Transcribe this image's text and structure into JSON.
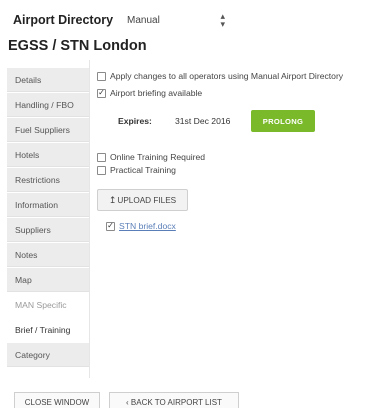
{
  "header": {
    "app_title": "Airport Directory",
    "mode_value": "Manual",
    "airport_title": "EGSS / STN London"
  },
  "tabs": [
    {
      "label": "Details"
    },
    {
      "label": "Handling / FBO"
    },
    {
      "label": "Fuel Suppliers"
    },
    {
      "label": "Hotels"
    },
    {
      "label": "Restrictions"
    },
    {
      "label": "Information"
    },
    {
      "label": "Suppliers"
    },
    {
      "label": "Notes"
    },
    {
      "label": "Map"
    },
    {
      "label": "MAN Specific"
    },
    {
      "label": "Brief / Training"
    },
    {
      "label": "Category"
    }
  ],
  "panel": {
    "apply_all_label": "Apply changes to all operators using Manual Airport Directory",
    "briefing_label": "Airport briefing available",
    "expires_label": "Expires:",
    "expires_date": "31st Dec 2016",
    "prolong_label": "PROLONG",
    "online_training_label": "Online Training Required",
    "practical_training_label": "Practical Training",
    "upload_label": "UPLOAD FILES",
    "file_name": "STN brief.docx"
  },
  "footer": {
    "close_label": "CLOSE WINDOW",
    "back_label": "‹ BACK TO AIRPORT LIST"
  },
  "colors": {
    "accent_green": "#7ab929",
    "link_blue": "#5a7fb8"
  }
}
